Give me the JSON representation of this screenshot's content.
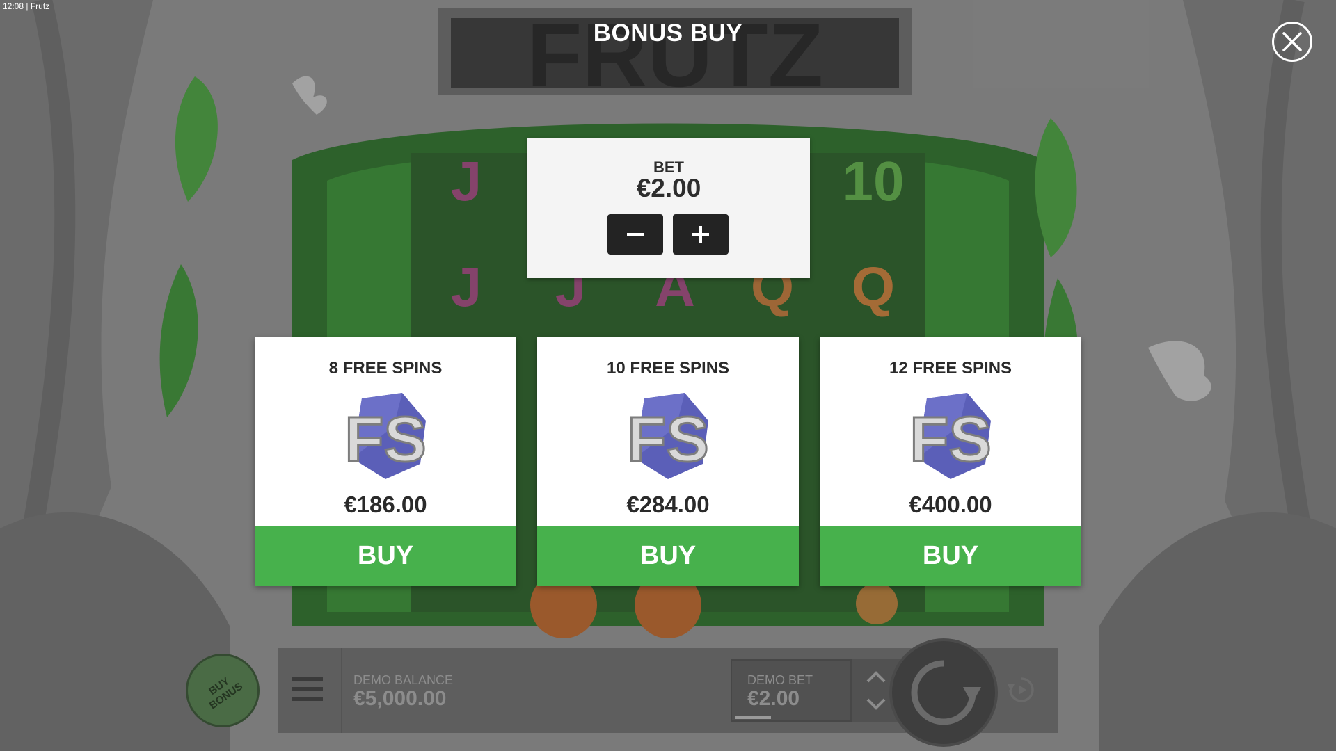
{
  "status_bar": {
    "time": "12:08",
    "app": "Frutz"
  },
  "game": {
    "logo_text": "FRUTZ",
    "reel_symbols": [
      "J",
      "10",
      "J",
      "J",
      "A",
      "Q",
      "Q"
    ]
  },
  "dialog": {
    "title": "BONUS BUY",
    "bet": {
      "label": "BET",
      "value": "€2.00"
    },
    "offers": [
      {
        "title": "8 FREE SPINS",
        "icon_text": "FS",
        "price": "€186.00",
        "buy_label": "BUY"
      },
      {
        "title": "10 FREE SPINS",
        "icon_text": "FS",
        "price": "€284.00",
        "buy_label": "BUY"
      },
      {
        "title": "12 FREE SPINS",
        "icon_text": "FS",
        "price": "€400.00",
        "buy_label": "BUY"
      }
    ]
  },
  "bottom_bar": {
    "buy_bonus_label": "BUY\nBONUS",
    "balance_label": "DEMO BALANCE",
    "balance_value": "€5,000.00",
    "bet_label": "DEMO BET",
    "bet_value": "€2.00"
  },
  "colors": {
    "buy_green": "#47b14c",
    "panel_white": "#ffffff",
    "dark_button": "#232323"
  },
  "icons": {
    "close": "close-icon",
    "minus": "minus-icon",
    "plus": "plus-icon",
    "menu": "hamburger-icon",
    "spin": "spin-icon",
    "autoplay": "autoplay-icon",
    "updown": "chevron-up-down-icon"
  }
}
